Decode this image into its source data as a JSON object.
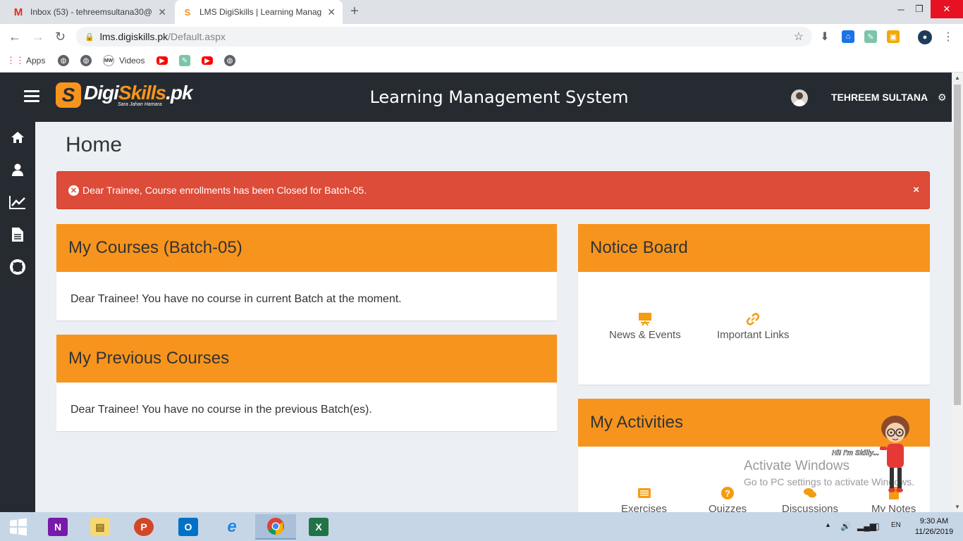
{
  "browser": {
    "tabs": [
      {
        "title": "Inbox (53) - tehreemsultana30@",
        "icon": "gmail-icon",
        "active": false
      },
      {
        "title": "LMS DigiSkills | Learning Manage",
        "icon": "digiskills-icon",
        "active": true
      }
    ],
    "url_host": "lms.digiskills.pk",
    "url_path": "/Default.aspx",
    "bookmarks": [
      {
        "label": "Apps",
        "icon": "apps-grid-icon"
      },
      {
        "label": "",
        "icon": "globe-icon"
      },
      {
        "label": "",
        "icon": "globe-icon"
      },
      {
        "label": "Videos",
        "icon": "mw-icon"
      },
      {
        "label": "",
        "icon": "youtube-icon"
      },
      {
        "label": "",
        "icon": "paperclip-icon"
      },
      {
        "label": "",
        "icon": "youtube-icon"
      },
      {
        "label": "",
        "icon": "globe-icon"
      }
    ]
  },
  "header": {
    "logo_text_1": "Digi",
    "logo_text_2": "Skills",
    "logo_text_3": ".pk",
    "logo_tagline": "Sara Jahan Hamara",
    "title": "Learning Management System",
    "username": "TEHREEM SULTANA"
  },
  "sidebar": {
    "items": [
      {
        "icon": "home-icon"
      },
      {
        "icon": "user-icon"
      },
      {
        "icon": "chart-line-icon"
      },
      {
        "icon": "document-icon"
      },
      {
        "icon": "lifebuoy-icon"
      }
    ]
  },
  "main": {
    "page_title": "Home",
    "alert": {
      "text": "Dear Trainee, Course enrollments has been Closed for Batch-05.",
      "close": "×",
      "color": "#dd4b39"
    },
    "my_courses": {
      "title": "My Courses (Batch-05)",
      "message": "Dear Trainee! You have no course in current Batch at the moment."
    },
    "previous_courses": {
      "title": "My Previous Courses",
      "message": "Dear Trainee! You have no course in the previous Batch(es)."
    },
    "notice_board": {
      "title": "Notice Board",
      "links": [
        {
          "label": "News & Events",
          "icon": "presentation-icon"
        },
        {
          "label": "Important Links",
          "icon": "link-icon"
        }
      ]
    },
    "activities": {
      "title": "My Activities",
      "links": [
        {
          "label": "Exercises",
          "icon": "list-icon"
        },
        {
          "label": "Quizzes",
          "icon": "question-icon"
        },
        {
          "label": "Discussions",
          "icon": "comments-icon"
        },
        {
          "label": "My Notes",
          "icon": "notes-icon"
        }
      ]
    },
    "accent_color": "#f7941d"
  },
  "skilly": {
    "bubble": "Hi! I'm Skilly..."
  },
  "watermark": {
    "line1": "Activate Windows",
    "line2": "Go to PC settings to activate Windows."
  },
  "taskbar": {
    "time": "9:30 AM",
    "date": "11/26/2019",
    "apps": [
      "start-icon",
      "onenote-icon",
      "file-explorer-icon",
      "powerpoint-icon",
      "outlook-icon",
      "internet-explorer-icon",
      "chrome-icon",
      "excel-icon"
    ]
  }
}
